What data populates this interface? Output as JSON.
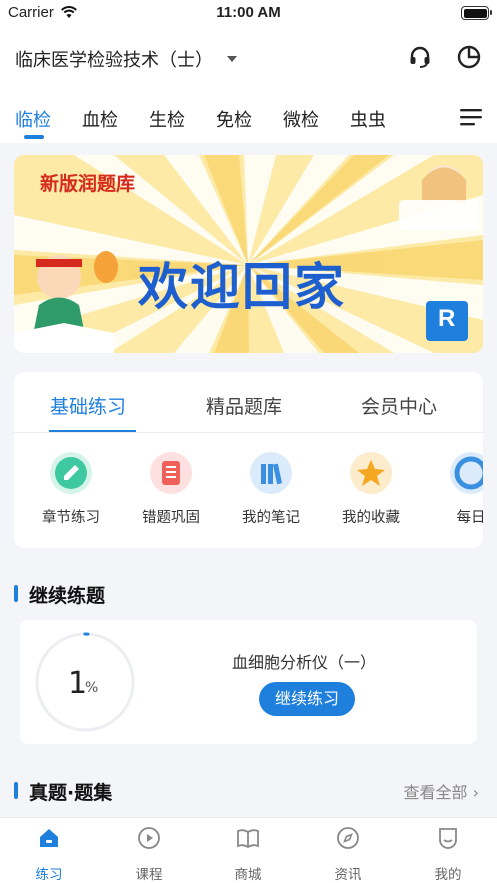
{
  "status_bar": {
    "carrier": "Carrier",
    "time": "11:00 AM"
  },
  "header": {
    "subject": "临床医学检验技术（士）",
    "icons": {
      "support": "headset-icon",
      "stats": "pie-chart-icon"
    }
  },
  "category_tabs": [
    {
      "label": "临检",
      "active": true
    },
    {
      "label": "血检",
      "active": false
    },
    {
      "label": "生检",
      "active": false
    },
    {
      "label": "免检",
      "active": false
    },
    {
      "label": "微检",
      "active": false
    },
    {
      "label": "虫虫",
      "active": false
    }
  ],
  "banner": {
    "badge": "新版润题库",
    "headline": "欢迎回家",
    "logo_letter": "R"
  },
  "practice_card": {
    "tabs": [
      {
        "label": "基础练习",
        "active": true
      },
      {
        "label": "精品题库",
        "active": false
      },
      {
        "label": "会员中心",
        "active": false
      }
    ],
    "features": [
      {
        "label": "章节练习",
        "icon": "pencil-icon",
        "color": "#3ec9a0"
      },
      {
        "label": "错题巩固",
        "icon": "list-icon",
        "color": "#f0605a"
      },
      {
        "label": "我的笔记",
        "icon": "books-icon",
        "color": "#3a8fe0"
      },
      {
        "label": "我的收藏",
        "icon": "star-icon",
        "color": "#f5a623"
      },
      {
        "label": "每日",
        "icon": "calendar-icon",
        "color": "#3a8fe0"
      }
    ]
  },
  "continue_section": {
    "title": "继续练题",
    "progress_value": "1",
    "progress_unit": "%",
    "progress_fraction": 0.01,
    "lesson": "血细胞分析仪（一）",
    "button": "继续练习"
  },
  "exam_section": {
    "title": "真题·题集",
    "view_all": "查看全部 ›"
  },
  "tabbar": [
    {
      "label": "练习",
      "icon": "home-icon",
      "active": true
    },
    {
      "label": "课程",
      "icon": "play-icon",
      "active": false
    },
    {
      "label": "商城",
      "icon": "book-icon",
      "active": false
    },
    {
      "label": "资讯",
      "icon": "compass-icon",
      "active": false
    },
    {
      "label": "我的",
      "icon": "profile-icon",
      "active": false
    }
  ],
  "colors": {
    "accent": "#1e7fdc",
    "banner_bg": "#fde9a3",
    "banner_red": "#d62a1e",
    "banner_blue": "#1e5fd0"
  }
}
